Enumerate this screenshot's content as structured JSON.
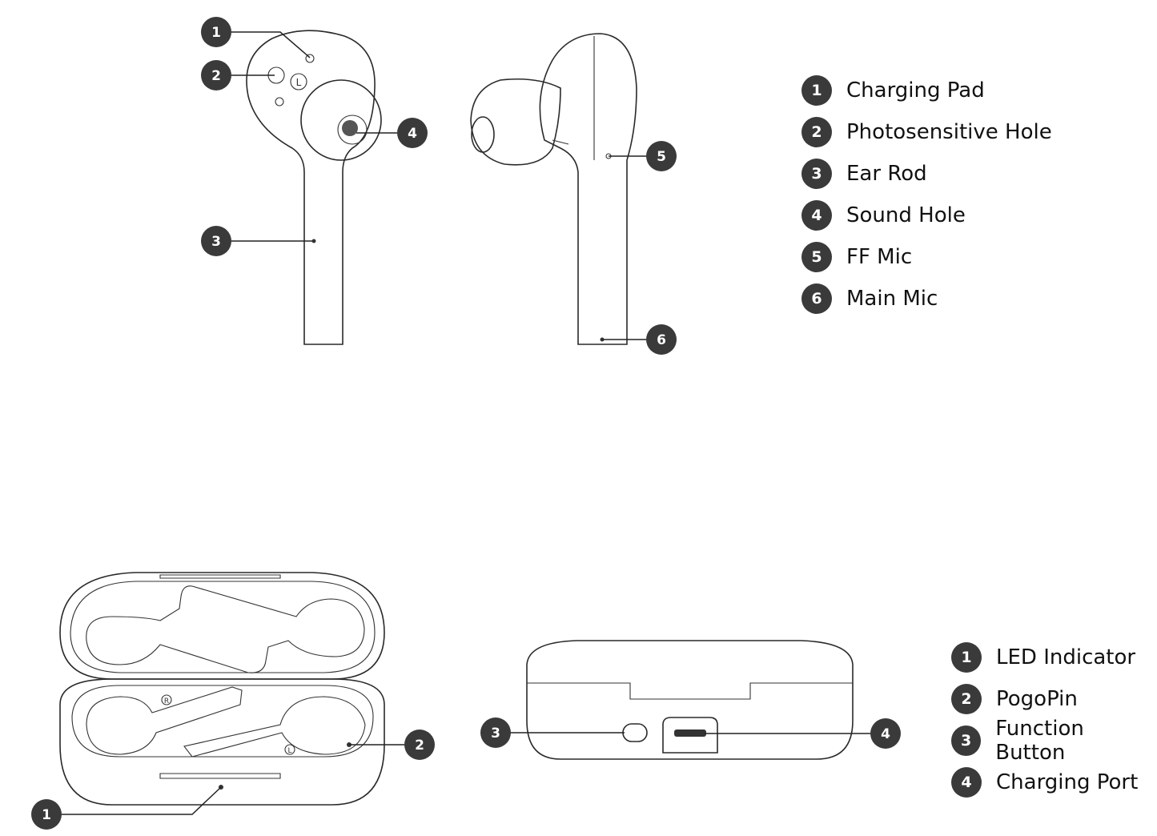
{
  "earbud_legend": [
    {
      "num": "1",
      "label": "Charging Pad"
    },
    {
      "num": "2",
      "label": "Photosensitive Hole"
    },
    {
      "num": "3",
      "label": "Ear Rod"
    },
    {
      "num": "4",
      "label": "Sound Hole"
    },
    {
      "num": "5",
      "label": "FF Mic"
    },
    {
      "num": "6",
      "label": "Main Mic"
    }
  ],
  "case_legend": [
    {
      "num": "1",
      "label": "LED Indicator"
    },
    {
      "num": "2",
      "label": "PogoPin"
    },
    {
      "num": "3",
      "label": "Function Button"
    },
    {
      "num": "4",
      "label": "Charging Port"
    }
  ],
  "earbud_marks": {
    "left": "L",
    "case_left": "L",
    "case_right": "R"
  },
  "badge_color": "#3a3a3a"
}
